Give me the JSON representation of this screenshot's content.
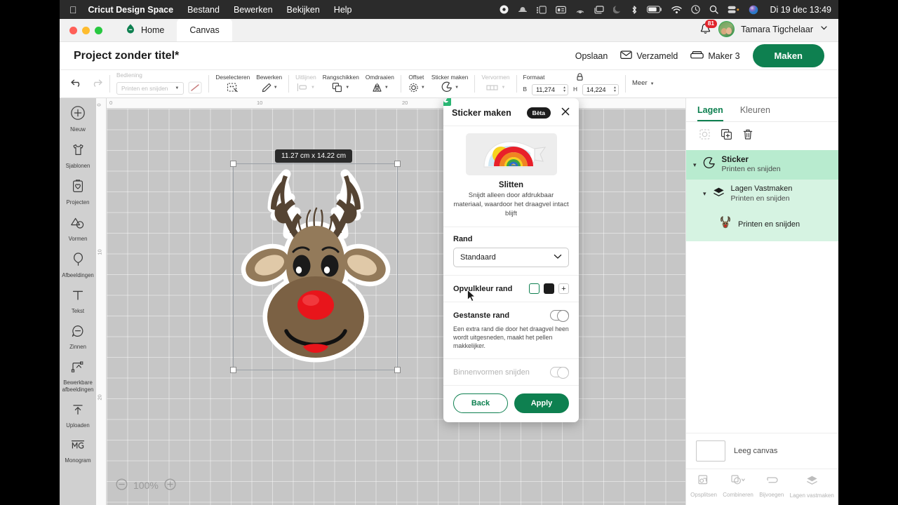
{
  "menubar": {
    "apple_icon": "apple-icon",
    "app_name": "Cricut Design Space",
    "items": [
      "Bestand",
      "Bewerken",
      "Bekijken",
      "Help"
    ],
    "status_icons": [
      "record-icon",
      "bowler-hat-icon",
      "stage-manager-icon",
      "screenshot-icon",
      "airplay-icon",
      "window-icon",
      "dnd-moon-icon",
      "bluetooth-icon",
      "battery-icon",
      "wifi-icon",
      "time-machine-icon",
      "search-icon",
      "control-center-icon",
      "siri-icon"
    ],
    "clock": "Di 19 dec  13:49"
  },
  "window": {
    "tabs": [
      {
        "label": "Home",
        "icon": "home-icon",
        "active": false
      },
      {
        "label": "Canvas",
        "icon": "",
        "active": true
      }
    ],
    "notifications_count": "81",
    "user_name": "Tamara Tigchelaar"
  },
  "titlebar": {
    "project_title": "Project zonder titel*",
    "save_label": "Opslaan",
    "collected_label": "Verzameld",
    "machine_label": "Maker 3",
    "make_label": "Maken"
  },
  "toolbar": {
    "undo_icon": "undo-icon",
    "redo_icon": "redo-icon",
    "operation_label": "Bediening",
    "operation_value": "Printen en snijden",
    "deselect_label": "Deselecteren",
    "edit_label": "Bewerken",
    "align_label": "Uitlijnen",
    "arrange_label": "Rangschikken",
    "flip_label": "Omdraaien",
    "offset_label": "Offset",
    "sticker_label": "Sticker maken",
    "deform_label": "Vervormen",
    "size_label": "Formaat",
    "width_prefix": "B",
    "width_value": "11,274",
    "height_prefix": "H",
    "height_value": "14,224",
    "lock_icon": "lock-icon",
    "more_label": "Meer"
  },
  "rail": {
    "items": [
      {
        "label": "Nieuw",
        "icon": "plus-circle-icon"
      },
      {
        "label": "Sjablonen",
        "icon": "shirt-icon"
      },
      {
        "label": "Projecten",
        "icon": "clipboard-heart-icon"
      },
      {
        "label": "Vormen",
        "icon": "shapes-icon"
      },
      {
        "label": "Afbeeldingen",
        "icon": "balloon-icon"
      },
      {
        "label": "Tekst",
        "icon": "text-icon"
      },
      {
        "label": "Zinnen",
        "icon": "speech-bubble-icon"
      },
      {
        "label": "Bewerkbare afbeeldingen",
        "icon": "editable-image-icon"
      },
      {
        "label": "Uploaden",
        "icon": "upload-icon"
      },
      {
        "label": "Monogram",
        "icon": "monogram-icon"
      }
    ]
  },
  "canvas": {
    "size_badge": "11.27  cm x 14.22  cm",
    "zoom_level": "100%",
    "zoom_out_icon": "minus-circle-icon",
    "zoom_in_icon": "plus-circle-icon",
    "ruler_h_ticks": [
      "0",
      "10",
      "20"
    ],
    "ruler_v_ticks": [
      "0",
      "10",
      "20"
    ],
    "artwork": "reindeer-sticker",
    "colors": {
      "fur": "#937a5a",
      "fur_dark": "#7b6144",
      "antler": "#554433",
      "ear_inner": "#e0c9a8",
      "nose": "#e8151b",
      "outline": "#ffffff"
    }
  },
  "dialog": {
    "title": "Sticker maken",
    "beta_label": "Bèta",
    "close_icon": "close-icon",
    "thumb_icon": "rainbow-sticker-thumb",
    "heading": "Slitten",
    "description": "Snijdt alleen door afdrukbaar materiaal, waardoor het draagvel intact blijft",
    "border_label": "Rand",
    "border_value": "Standaard",
    "fill_label": "Opvulkleur rand",
    "swatch_white": "#ffffff",
    "swatch_black": "#1c1c1c",
    "add_swatch_label": "+",
    "kiss_cut_label": "Gestanste rand",
    "kiss_cut_desc": "Een extra rand die door het draagvel heen wordt uitgesneden, maakt het pellen makkelijker.",
    "inner_cut_label": "Binnenvormen snijden",
    "back_label": "Back",
    "apply_label": "Apply"
  },
  "panel": {
    "tabs": [
      {
        "label": "Lagen",
        "active": true
      },
      {
        "label": "Kleuren",
        "active": false
      }
    ],
    "tool_icons": [
      "slice-icon",
      "duplicate-icon",
      "delete-icon"
    ],
    "layers": [
      {
        "title": "Sticker",
        "subtitle": "Printen en snijden",
        "icon": "sticker-icon",
        "level": 0
      },
      {
        "title": "Lagen Vastmaken",
        "subtitle": "Printen en snijden",
        "icon": "flatten-icon",
        "level": 1
      },
      {
        "title": "",
        "subtitle": "Printen en snijden",
        "icon": "reindeer-icon",
        "level": 2
      }
    ],
    "empty_canvas_label": "Leeg canvas",
    "footer": [
      {
        "label": "Opsplitsen",
        "icon": "slice-icon"
      },
      {
        "label": "Combineren",
        "icon": "weld-icon"
      },
      {
        "label": "Bijvoegen",
        "icon": "attach-icon"
      },
      {
        "label": "Lagen vastmaken",
        "icon": "flatten-icon"
      }
    ]
  }
}
